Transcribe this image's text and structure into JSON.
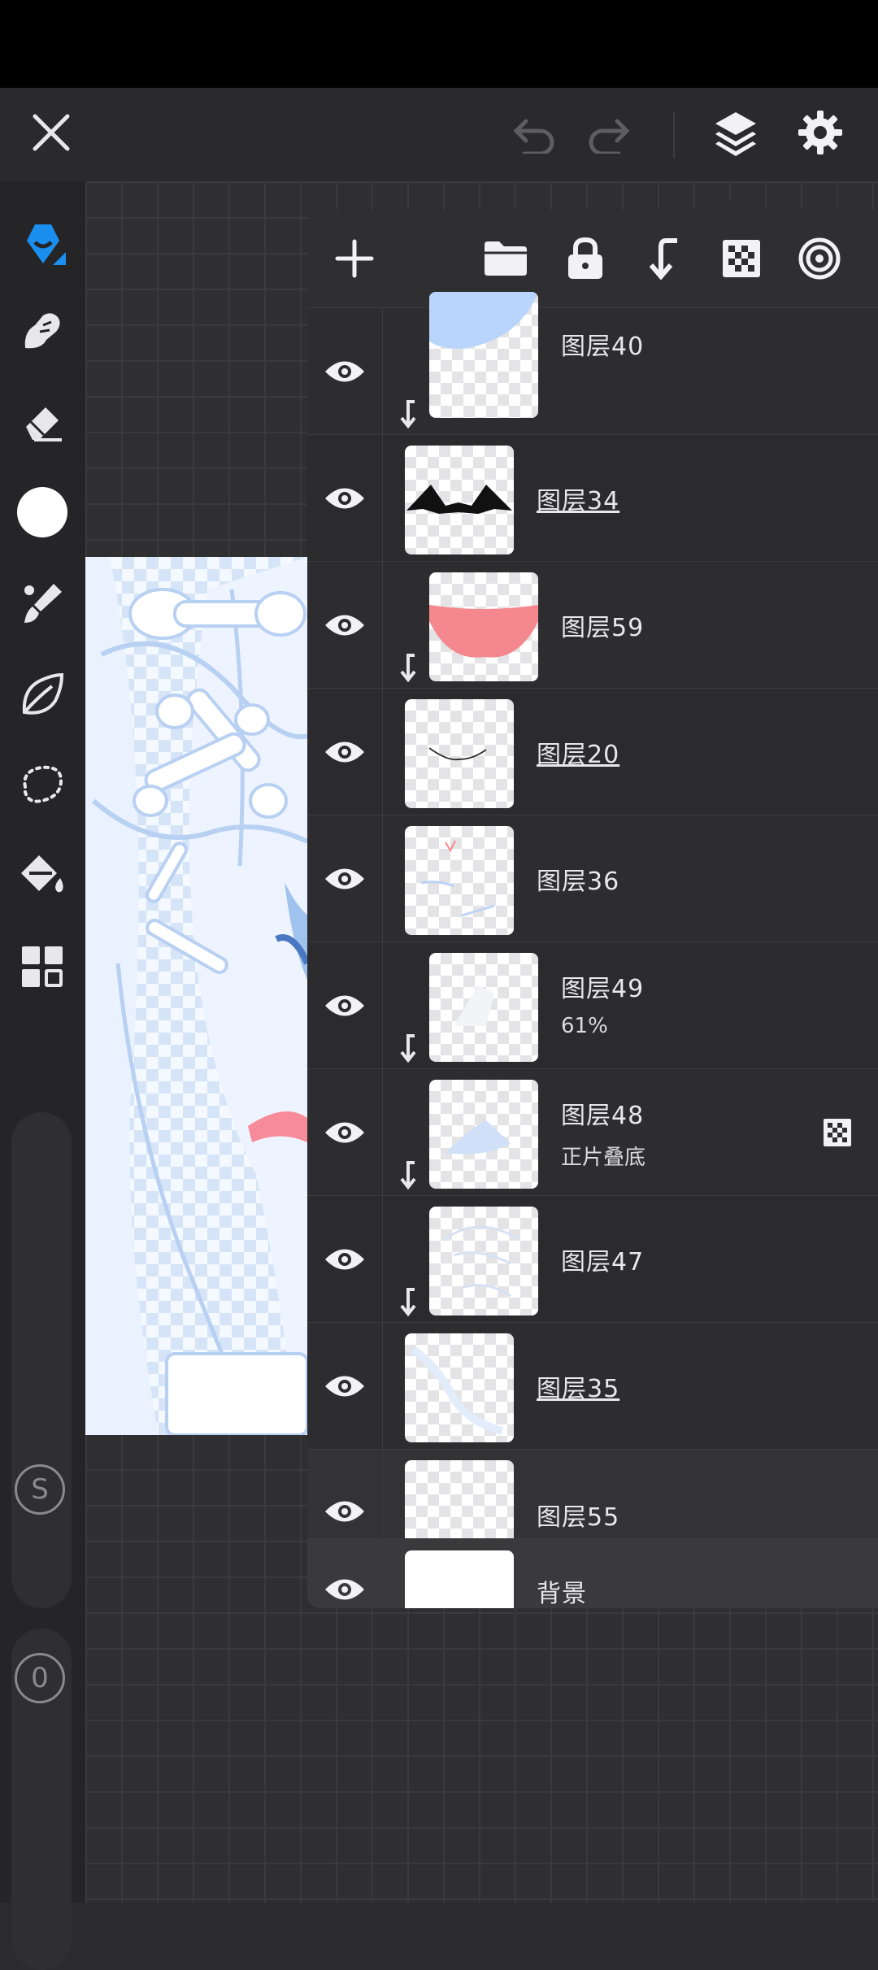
{
  "topbar": {
    "close": "close-icon",
    "undo": "undo-icon",
    "redo": "redo-icon",
    "layers": "layers-icon",
    "settings": "gear-icon"
  },
  "tools": [
    "pen-icon",
    "smudge-icon",
    "eraser-icon",
    "color-swatch",
    "brush-icon",
    "leaf-icon",
    "lasso-icon",
    "fill-bucket-icon",
    "grid-icon"
  ],
  "sliders": {
    "size_label": "S",
    "opacity_label": "0"
  },
  "panel_toolbar": [
    "add-icon",
    "folder-icon",
    "lock-icon",
    "clip-icon",
    "checker-icon",
    "target-icon"
  ],
  "layers": [
    {
      "name": "图层40",
      "sub": "",
      "clipped": true
    },
    {
      "name": "图层34",
      "sub": "",
      "clipped": false
    },
    {
      "name": "图层59",
      "sub": "",
      "clipped": true
    },
    {
      "name": "图层20",
      "sub": "",
      "clipped": false
    },
    {
      "name": "图层36",
      "sub": "",
      "clipped": false
    },
    {
      "name": "图层49",
      "sub": "61%",
      "clipped": true
    },
    {
      "name": "图层48",
      "sub": "正片叠底",
      "clipped": true
    },
    {
      "name": "图层47",
      "sub": "",
      "clipped": true
    },
    {
      "name": "图层35",
      "sub": "",
      "clipped": false
    },
    {
      "name": "图层55",
      "sub": "",
      "clipped": false
    }
  ],
  "background_layer": {
    "name": "背景"
  },
  "colors": {
    "accent": "#1a8ff0",
    "current_color": "#ffffff"
  }
}
